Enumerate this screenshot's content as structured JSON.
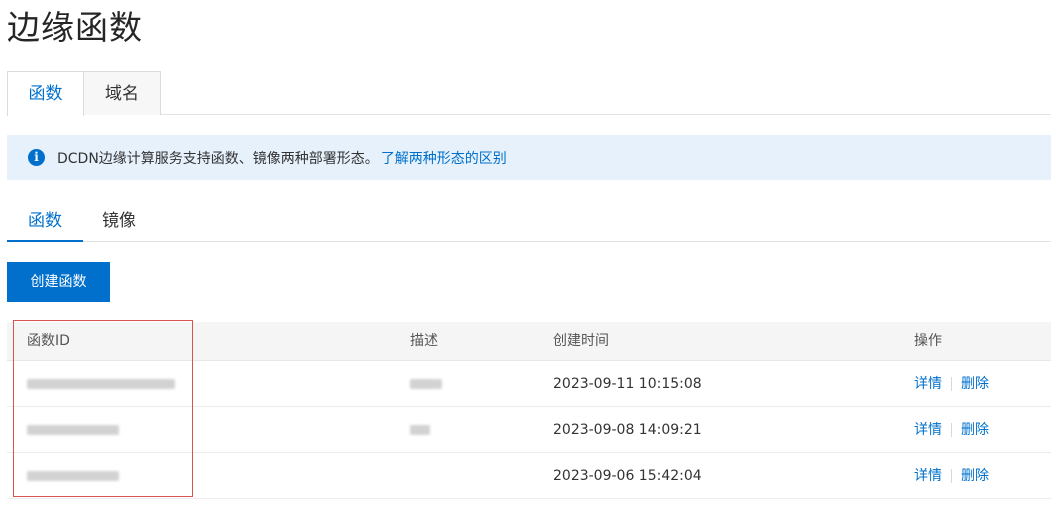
{
  "page": {
    "title": "边缘函数"
  },
  "top_tabs": [
    {
      "label": "函数",
      "active": true
    },
    {
      "label": "域名",
      "active": false
    }
  ],
  "banner": {
    "icon": "info-icon",
    "icon_glyph": "i",
    "text": "DCDN边缘计算服务支持函数、镜像两种部署形态。",
    "link": "了解两种形态的区别"
  },
  "sub_tabs": [
    {
      "label": "函数",
      "active": true
    },
    {
      "label": "镜像",
      "active": false
    }
  ],
  "toolbar": {
    "create_label": "创建函数"
  },
  "table": {
    "columns": [
      "函数ID",
      "描述",
      "创建时间",
      "操作"
    ],
    "rows": [
      {
        "function_id": "",
        "description": "",
        "created_at": "2023-09-11 10:15:08",
        "actions": [
          "详情",
          "删除"
        ]
      },
      {
        "function_id": "",
        "description": "",
        "created_at": "2023-09-08 14:09:21",
        "actions": [
          "详情",
          "删除"
        ]
      },
      {
        "function_id": "",
        "description": "",
        "created_at": "2023-09-06 15:42:04",
        "actions": [
          "详情",
          "删除"
        ]
      }
    ]
  },
  "colors": {
    "accent": "#0070cc",
    "banner_bg": "#e6f1fb",
    "highlight": "#d9534f"
  }
}
